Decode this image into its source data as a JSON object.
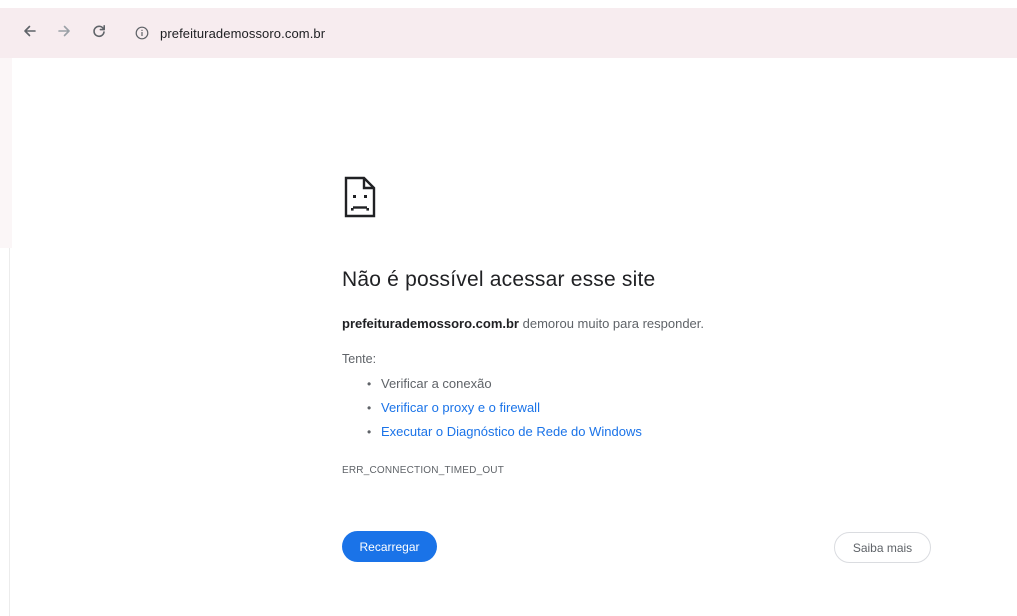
{
  "browser": {
    "nav": {
      "back_icon": "back-arrow-icon",
      "forward_icon": "forward-arrow-icon",
      "reload_icon": "reload-icon"
    },
    "address_bar": {
      "url": "prefeiturademossoro.com.br",
      "site_info_icon": "info-circle-icon"
    },
    "toolbar_color": "#f7ecef"
  },
  "error_page": {
    "icon": "sad-page-icon",
    "title": "Não é possível acessar esse site",
    "summary": {
      "host": "prefeiturademossoro.com.br",
      "message": " demorou muito para responder."
    },
    "try_label": "Tente:",
    "suggestions": [
      {
        "text": "Verificar a conexão",
        "is_link": false
      },
      {
        "text": "Verificar o proxy e o firewall",
        "is_link": true
      },
      {
        "text": "Executar o Diagnóstico de Rede do Windows",
        "is_link": true
      }
    ],
    "error_code": "ERR_CONNECTION_TIMED_OUT",
    "buttons": {
      "reload": "Recarregar",
      "details": "Saiba mais"
    },
    "colors": {
      "primary_button": "#1a73e8",
      "link": "#1a73e8",
      "text_secondary": "#5f6368"
    }
  }
}
